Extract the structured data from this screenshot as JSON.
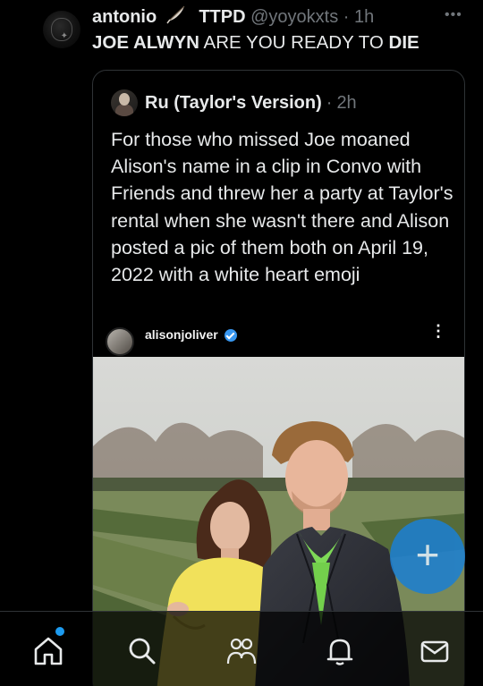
{
  "tweet": {
    "author_name": "antonio",
    "author_tag": "TTPD",
    "handle": "@yoyokxts",
    "separator": "·",
    "time": "1h",
    "more_icon": "more-dots-icon",
    "text_part1": "JOE ALWYN",
    "text_part2": " ARE YOU READY TO ",
    "text_part3": "DIE"
  },
  "quote": {
    "author_name": "Ru (Taylor's Version)",
    "separator": "·",
    "time": "2h",
    "text": "For those who missed Joe moaned Alison's name in a clip in Convo with Friends and threw her a party at Taylor's rental when she wasn't there and Alison posted a pic of them both on April 19, 2022 with a white heart emoji",
    "photo": {
      "ig_username": "alisonjoliver",
      "ig_menu": "⋮"
    }
  },
  "compose_button": {
    "label": "+"
  },
  "nav": {
    "items": [
      "home-icon",
      "search-icon",
      "communities-icon",
      "notifications-icon",
      "messages-icon"
    ]
  },
  "colors": {
    "background": "#000000",
    "text": "#e7e9ea",
    "muted": "#71767b",
    "accent": "#1d9bf0",
    "border": "#2f3336"
  }
}
